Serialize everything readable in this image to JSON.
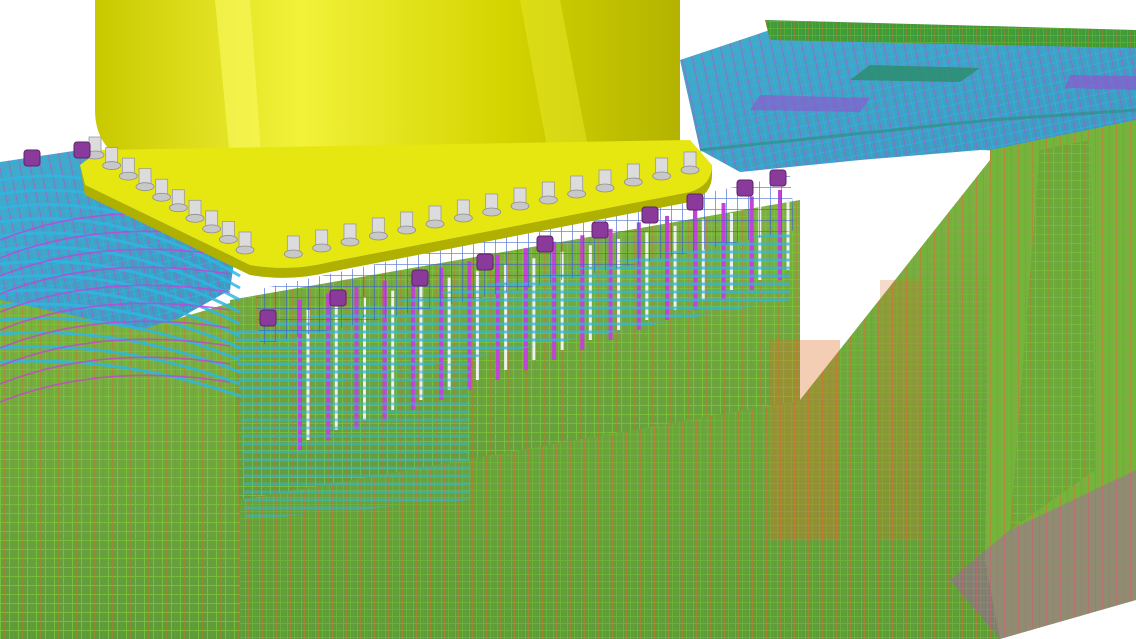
{
  "scene": {
    "subject": "3d-rebar-model",
    "colors": {
      "background": "#ffffff",
      "steel_column": "#d6d600",
      "steel_column_light": "#eded2a",
      "steel_column_dark": "#a8a800",
      "base_plate": "#e6e610",
      "concrete_face": "#8fb04a",
      "slab_top": "#3fa7c9",
      "rebar_green": "#66b32e",
      "rebar_cyan": "#2fb6e0",
      "rebar_magenta": "#c43fd8",
      "rebar_orange": "#e0702a",
      "rebar_blue": "#3a5fcf",
      "anchor_bolt": "#d8d8d8",
      "anchor_nut_purple": "#8a3a9a",
      "slab_edge": "#3f9a3a"
    }
  }
}
